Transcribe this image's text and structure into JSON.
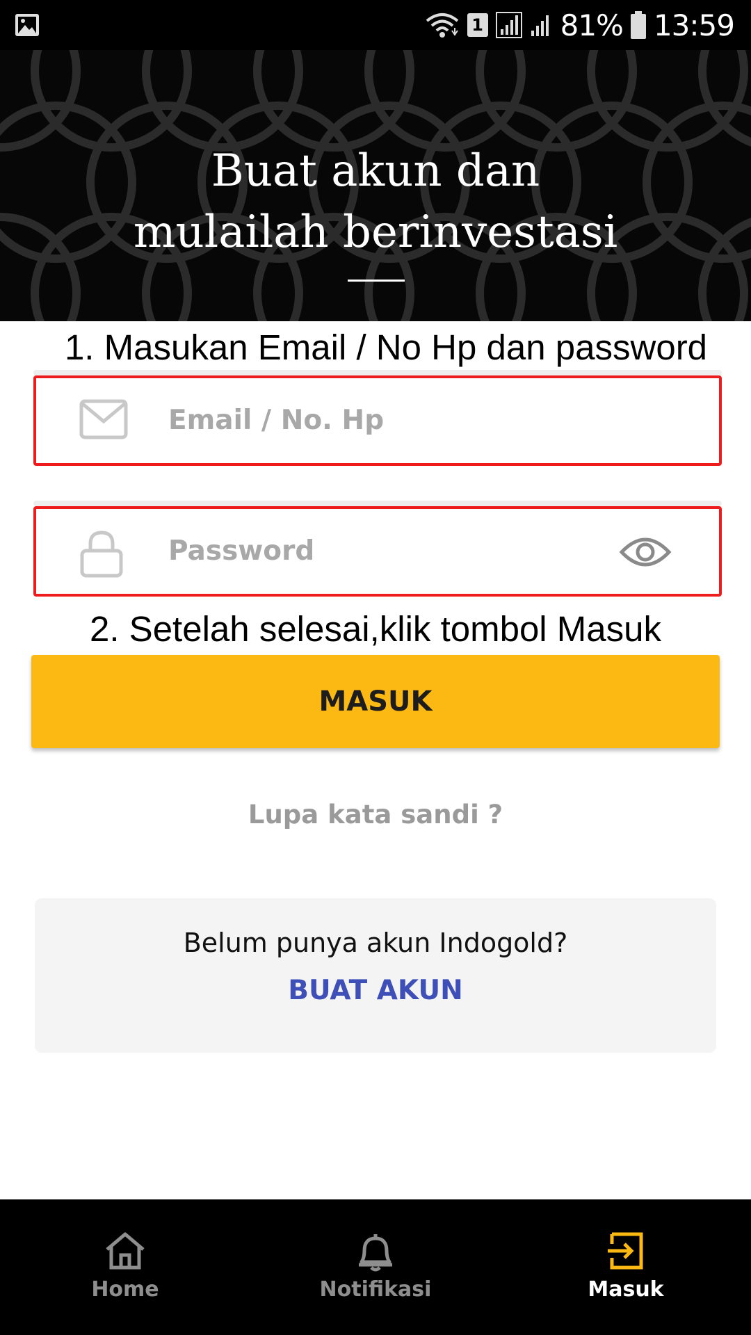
{
  "status_bar": {
    "sim_badge": "1",
    "battery": "81%",
    "time": "13:59"
  },
  "hero": {
    "title_line1": "Buat akun dan",
    "title_line2": "mulailah berinvestasi"
  },
  "annotations": {
    "step1": "1. Masukan Email / No Hp dan password",
    "step2": "2. Setelah selesai,klik tombol Masuk"
  },
  "form": {
    "email_placeholder": "Email / No. Hp",
    "password_placeholder": "Password",
    "submit_label": "MASUK",
    "forgot_label": "Lupa kata sandi ?"
  },
  "signup": {
    "question": "Belum punya akun Indogold?",
    "link_label": "BUAT AKUN"
  },
  "bottom_nav": {
    "items": [
      {
        "label": "Home",
        "icon": "home-icon",
        "active": false
      },
      {
        "label": "Notifikasi",
        "icon": "bell-icon",
        "active": false
      },
      {
        "label": "Masuk",
        "icon": "login-icon",
        "active": true
      }
    ]
  },
  "colors": {
    "accent": "#fdb913",
    "annotation_box": "#ee1c1c",
    "link": "#3e4fb8",
    "nav_active_icon": "#fdb913"
  }
}
